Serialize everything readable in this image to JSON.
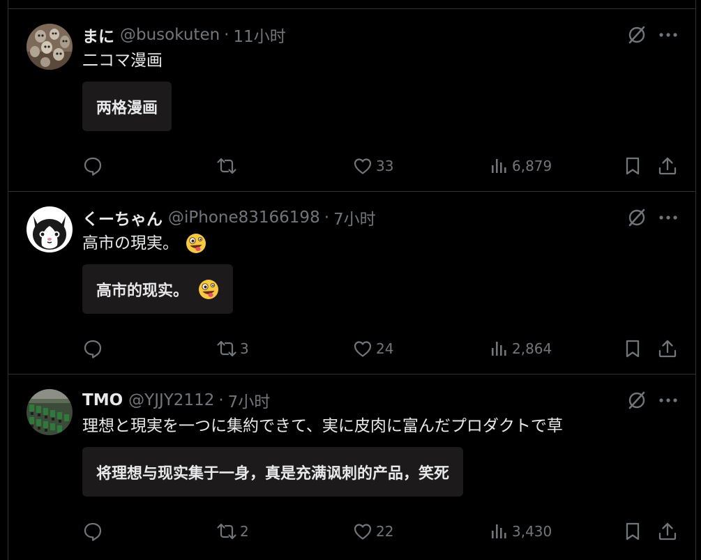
{
  "posts": [
    {
      "display_name": "まに",
      "handle": "@busokuten",
      "separator": "·",
      "time": "11小时",
      "text": "二コマ漫画",
      "translation": "两格漫画",
      "has_emoji": false,
      "avatar_icon": "owls-photo-avatar",
      "replies": "",
      "reposts": "",
      "likes": "33",
      "views": "6,879"
    },
    {
      "display_name": "くーちゃん",
      "handle": "@iPhone83166198",
      "separator": "·",
      "time": "7小时",
      "text": "高市の現実。",
      "translation": "高市的现实。",
      "has_emoji": true,
      "avatar_icon": "cartoon-cat-avatar",
      "replies": "",
      "reposts": "3",
      "likes": "24",
      "views": "2,864"
    },
    {
      "display_name": "TMO",
      "handle": "@YJJY2112",
      "separator": "·",
      "time": "7小时",
      "text": "理想と現実を一つに集約できて、実に皮肉に富んだプロダクトで草",
      "translation": "将理想与现实集于一身，真是充满讽刺的产品，笑死",
      "has_emoji": false,
      "avatar_icon": "green-machines-photo-avatar",
      "replies": "",
      "reposts": "2",
      "likes": "22",
      "views": "3,430"
    }
  ],
  "colors": {
    "background": "#000000",
    "text": "#e7e9ea",
    "muted": "#71767b",
    "border": "#2f3336",
    "translation_box": "#1c1a1a"
  },
  "icons": {
    "emoji": "zany-face-emoji",
    "grok": "grok-icon",
    "more": "more-dots-icon",
    "reply": "reply-icon",
    "repost": "repost-icon",
    "like": "heart-icon",
    "views": "views-bar-chart-icon",
    "bookmark": "bookmark-icon",
    "share": "share-icon"
  }
}
